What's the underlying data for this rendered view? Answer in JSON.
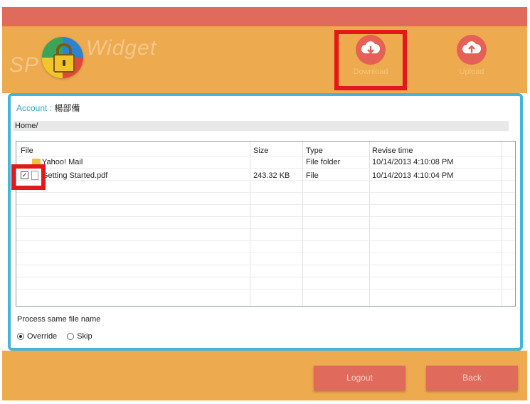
{
  "app": {
    "logo_prefix": "SP",
    "logo_suffix": "Widget"
  },
  "header": {
    "download_label": "Download",
    "upload_label": "Upload"
  },
  "account": {
    "label": "Account : ",
    "name": "楊部備"
  },
  "path": "Home/",
  "file_list": {
    "columns": [
      "File",
      "Size",
      "Type",
      "Revise time"
    ],
    "rows": [
      {
        "name": "Yahoo! Mail",
        "size": "",
        "type": "File folder",
        "revised": "10/14/2013 4:10:08 PM",
        "checked": false,
        "kind": "folder"
      },
      {
        "name": "Getting Started.pdf",
        "size": "243.32 KB",
        "type": "File",
        "revised": "10/14/2013 4:10:04 PM",
        "checked": true,
        "kind": "file"
      }
    ]
  },
  "process": {
    "label": "Process same file name",
    "options": [
      {
        "label": "Override",
        "selected": true
      },
      {
        "label": "Skip",
        "selected": false
      }
    ]
  },
  "footer": {
    "logout_label": "Logout",
    "back_label": "Back"
  },
  "colors": {
    "header_bg": "#eeaa4e",
    "top_strip": "#e06a5c",
    "accent_border": "#46b3d8",
    "button_red": "#e06a5c",
    "highlight": "#e3181d"
  }
}
